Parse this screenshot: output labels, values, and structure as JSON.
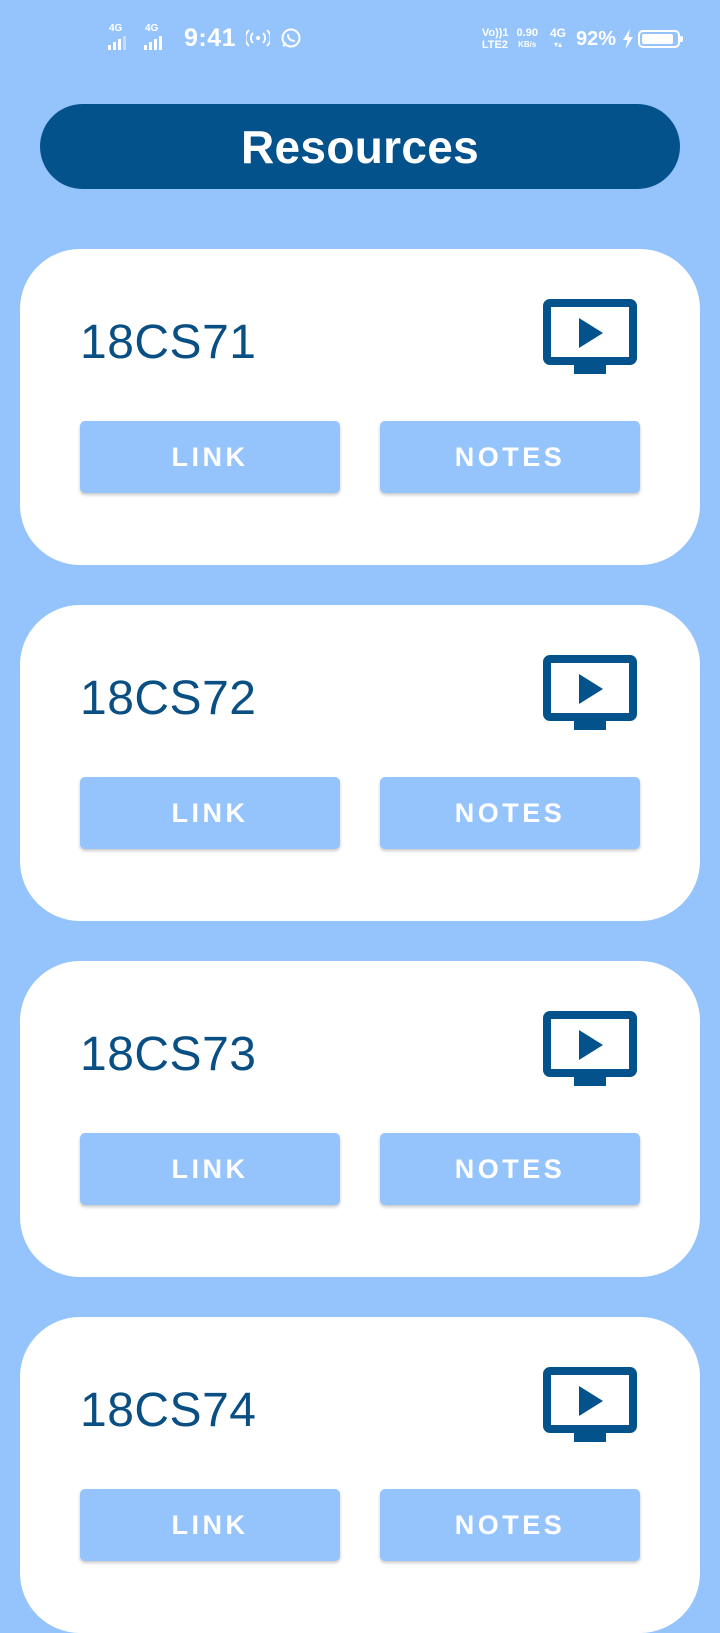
{
  "status_bar": {
    "sim1_network": "4G",
    "sim2_network": "4G",
    "time": "9:41",
    "volte_line1": "Vo))1",
    "volte_line2": "LTE2",
    "speed_value": "0.90",
    "speed_unit": "KB/s",
    "data_network": "4G",
    "battery_percent": "92%",
    "battery_level": 0.92,
    "icons": [
      "signal-icon",
      "hotspot-icon",
      "whatsapp-icon",
      "bolt-icon",
      "battery-icon"
    ]
  },
  "header": {
    "title": "Resources"
  },
  "colors": {
    "background": "#95c4fd",
    "header_bg": "#04528c",
    "card_bg": "#ffffff",
    "course_text": "#0a4f84",
    "button_bg": "#95c4fd",
    "button_text": "#ffffff",
    "icon": "#04528c"
  },
  "courses": [
    {
      "code": "18CS71",
      "link_label": "LINK",
      "notes_label": "NOTES",
      "icon": "video-play-icon"
    },
    {
      "code": "18CS72",
      "link_label": "LINK",
      "notes_label": "NOTES",
      "icon": "video-play-icon"
    },
    {
      "code": "18CS73",
      "link_label": "LINK",
      "notes_label": "NOTES",
      "icon": "video-play-icon"
    },
    {
      "code": "18CS74",
      "link_label": "LINK",
      "notes_label": "NOTES",
      "icon": "video-play-icon"
    }
  ]
}
